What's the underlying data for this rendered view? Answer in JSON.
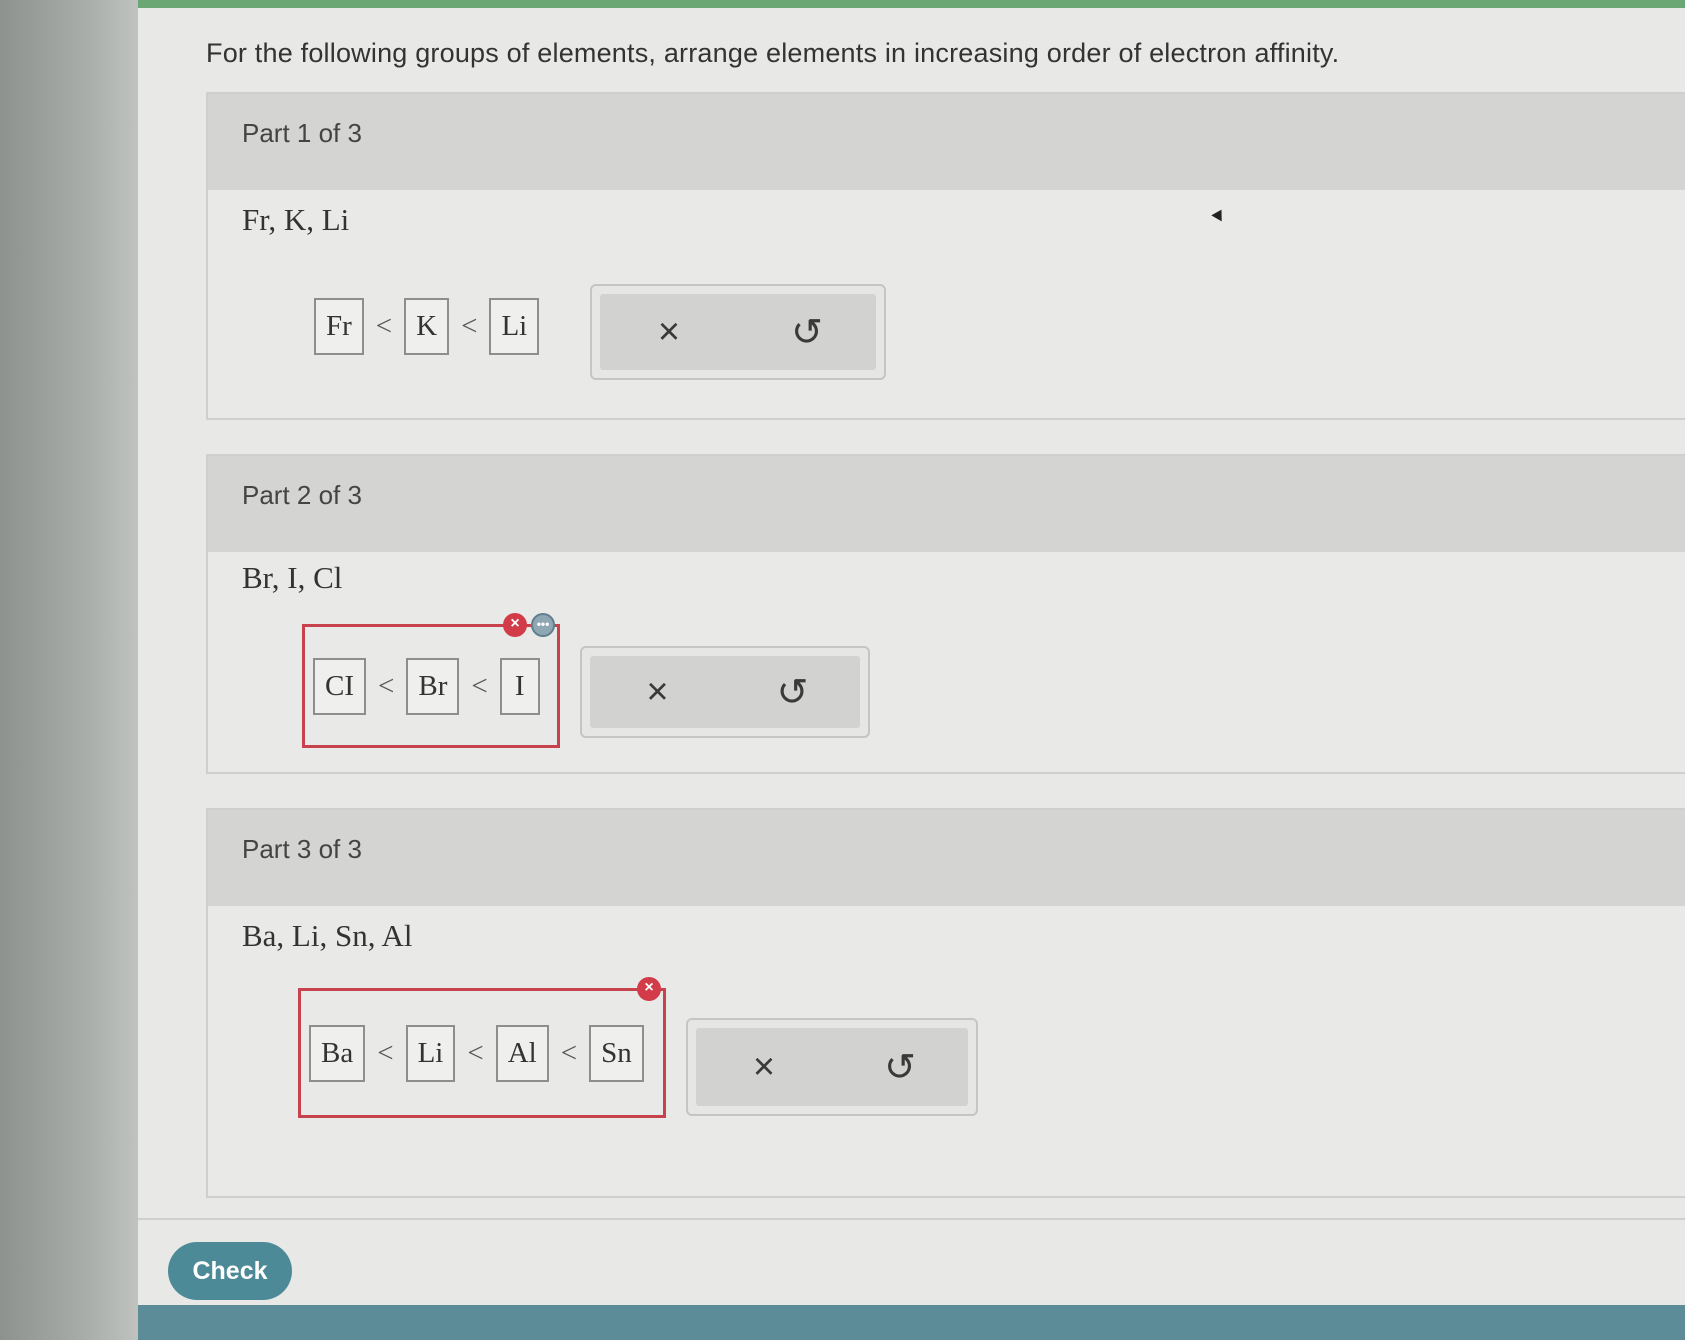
{
  "instruction": "For the following groups of elements, arrange elements in increasing order of electron affinity.",
  "parts": [
    {
      "header": "Part 1 of 3",
      "elements": "Fr, K, Li",
      "answer": [
        "Fr",
        "K",
        "Li"
      ],
      "separator": "<",
      "status": "none"
    },
    {
      "header": "Part 2 of 3",
      "elements": "Br, I, Cl",
      "answer": [
        "CI",
        "Br",
        "I"
      ],
      "separator": "<",
      "status": "incorrect"
    },
    {
      "header": "Part 3 of 3",
      "elements": "Ba, Li, Sn, Al",
      "answer": [
        "Ba",
        "Li",
        "Al",
        "Sn"
      ],
      "separator": "<",
      "status": "incorrect"
    }
  ],
  "tools": {
    "clear_glyph": "×",
    "reset_glyph": "↺"
  },
  "check_label": "Check",
  "colors": {
    "error": "#c8424d",
    "check_button": "#4d8a97",
    "top_bar": "#6aa775"
  }
}
